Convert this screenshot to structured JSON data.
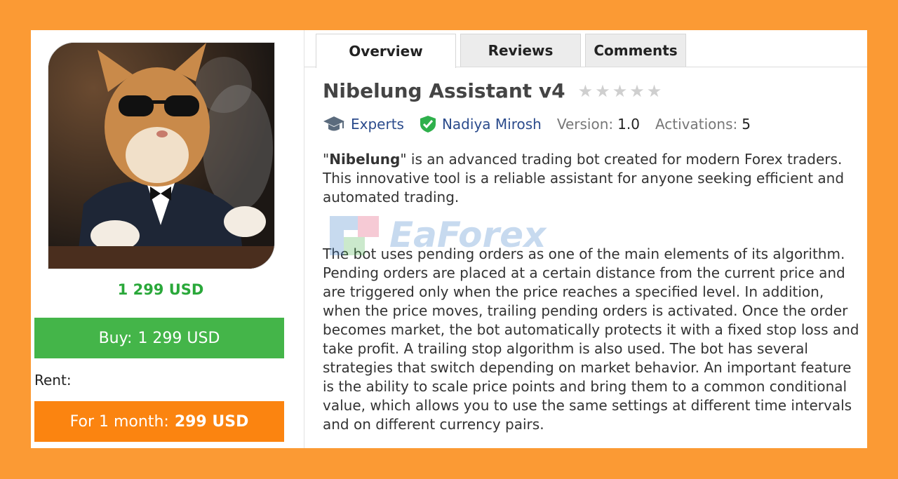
{
  "product": {
    "price_label": "1 299 USD",
    "buy_prefix": "Buy:",
    "buy_price": "1 299 USD",
    "rent_label": "Rent:",
    "rent_prefix": "For 1 month:",
    "rent_price": "299 USD"
  },
  "tabs": [
    {
      "label": "Overview",
      "active": true
    },
    {
      "label": "Reviews",
      "active": false
    },
    {
      "label": "Comments",
      "active": false
    }
  ],
  "header": {
    "title": "Nibelung Assistant v4",
    "rating": 0,
    "rating_max": 5
  },
  "meta": {
    "category": "Experts",
    "author": "Nadiya Mirosh",
    "version_label": "Version:",
    "version_value": "1.0",
    "activations_label": "Activations:",
    "activations_value": "5"
  },
  "description": {
    "p1_bold": "Nibelung",
    "p1_open_quote": "\"",
    "p1_rest": "\" is an advanced trading bot created for modern Forex traders. This innovative tool is a reliable assistant for anyone seeking efficient and automated trading.",
    "p2": "The bot uses pending orders as one of the main elements of its algorithm. Pending orders are placed at a certain distance from the current price and are triggered only when the price reaches a specified level. In addition, when the price moves, trailing pending orders is activated. Once the order becomes market, the bot automatically protects it with a fixed stop loss and take profit. A trailing stop algorithm is also used. The bot has several strategies that switch depending on market behavior. An important feature is the ability to scale price points and bring them to a common conditional value, which allows you to use the same settings at different time intervals and on different currency pairs."
  },
  "watermark": {
    "text": "EaForex"
  },
  "colors": {
    "background": "#fb9a34",
    "buy": "#44b549",
    "rent": "#fb8410",
    "price": "#2aa83a",
    "link": "#2b4b8c"
  }
}
